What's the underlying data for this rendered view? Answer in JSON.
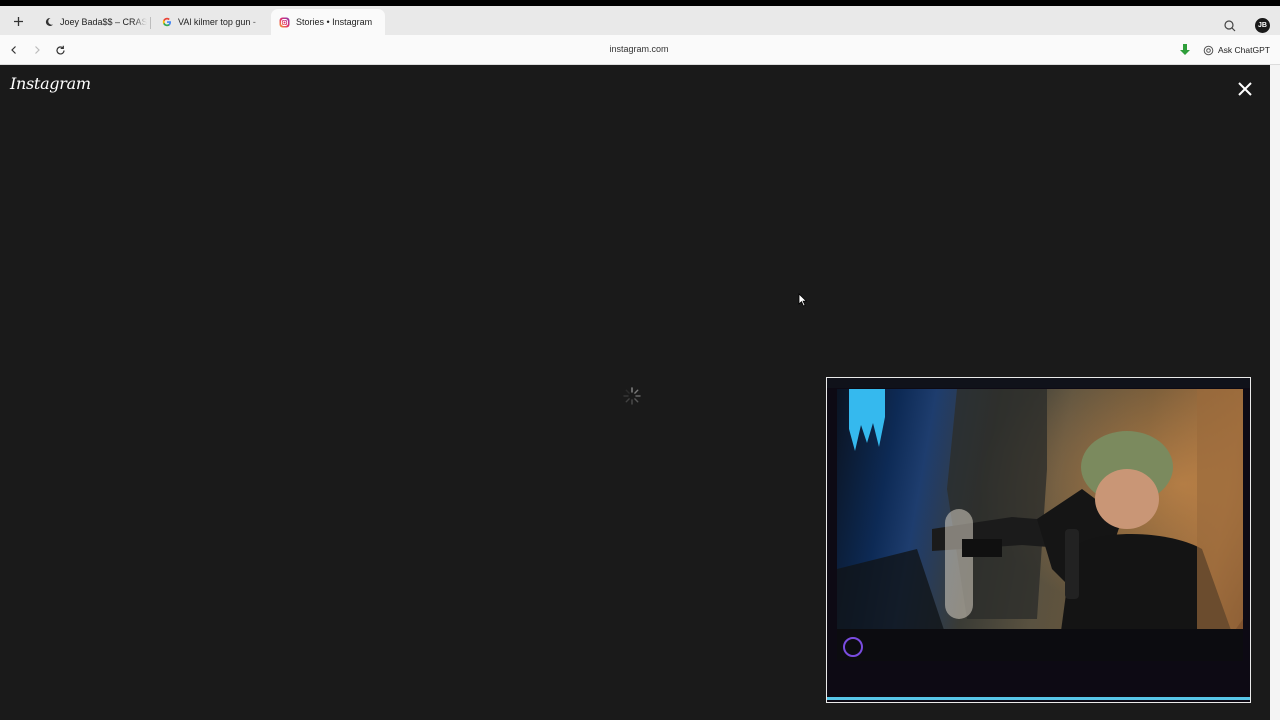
{
  "browser": {
    "new_tab_icon": "plus-icon",
    "tabs": [
      {
        "title": "Joey Bada$$ – CRAS",
        "favicon": "moon-icon",
        "active": false
      },
      {
        "title": "VAl kilmer top gun - ",
        "favicon": "google-g-icon",
        "active": false
      },
      {
        "title": "Stories • Instagram",
        "favicon": "instagram-icon",
        "active": true
      }
    ],
    "url": "instagram.com",
    "ask_chatgpt_label": "Ask ChatGPT",
    "profile_initials": "JB"
  },
  "page": {
    "logo_text": "Instagram",
    "background_color": "#1a1a1a",
    "accent_color": "#57c6e8"
  }
}
